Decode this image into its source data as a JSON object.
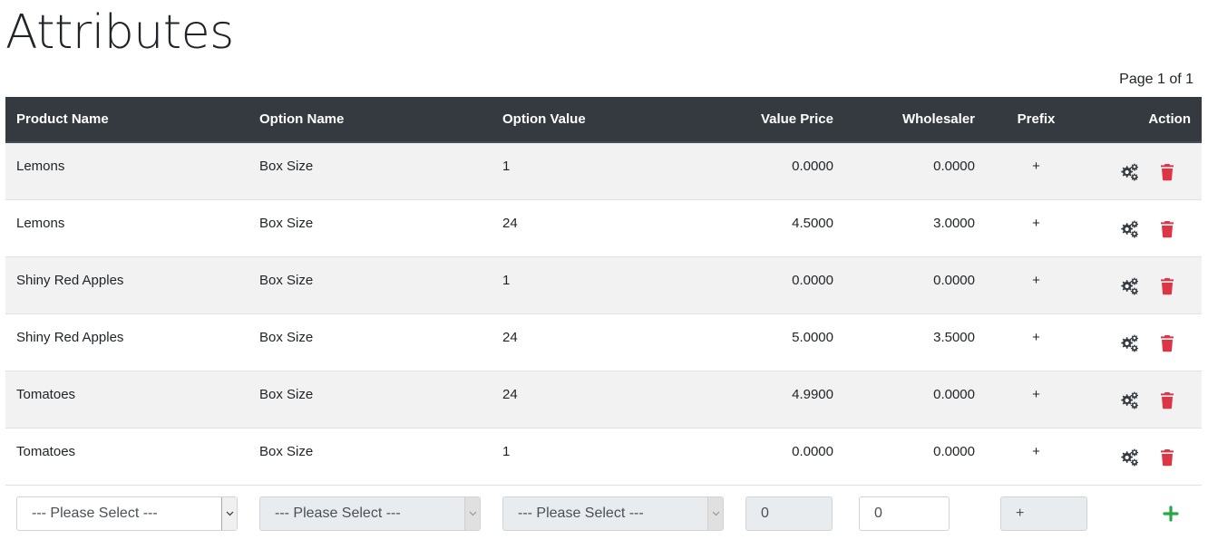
{
  "page": {
    "title": "Attributes",
    "pagination": "Page 1 of 1"
  },
  "table": {
    "headers": {
      "product_name": "Product Name",
      "option_name": "Option Name",
      "option_value": "Option Value",
      "value_price": "Value Price",
      "wholesaler": "Wholesaler",
      "prefix": "Prefix",
      "action": "Action"
    },
    "rows": [
      {
        "product_name": "Lemons",
        "option_name": "Box Size",
        "option_value": "1",
        "value_price": "0.0000",
        "wholesaler": "0.0000",
        "prefix": "+"
      },
      {
        "product_name": "Lemons",
        "option_name": "Box Size",
        "option_value": "24",
        "value_price": "4.5000",
        "wholesaler": "3.0000",
        "prefix": "+"
      },
      {
        "product_name": "Shiny Red Apples",
        "option_name": "Box Size",
        "option_value": "1",
        "value_price": "0.0000",
        "wholesaler": "0.0000",
        "prefix": "+"
      },
      {
        "product_name": "Shiny Red Apples",
        "option_name": "Box Size",
        "option_value": "24",
        "value_price": "5.0000",
        "wholesaler": "3.5000",
        "prefix": "+"
      },
      {
        "product_name": "Tomatoes",
        "option_name": "Box Size",
        "option_value": "24",
        "value_price": "4.9900",
        "wholesaler": "0.0000",
        "prefix": "+"
      },
      {
        "product_name": "Tomatoes",
        "option_name": "Box Size",
        "option_value": "1",
        "value_price": "0.0000",
        "wholesaler": "0.0000",
        "prefix": "+"
      }
    ]
  },
  "add_row": {
    "product_select": "--- Please Select ---",
    "option_select": "--- Please Select ---",
    "value_select": "--- Please Select ---",
    "value_price": "0",
    "wholesaler": "0",
    "prefix": "+"
  },
  "icons": {
    "edit": "cogs-icon",
    "delete": "trash-icon",
    "add": "plus-icon",
    "dropdown": "chevron-down-icon"
  },
  "colors": {
    "header_bg": "#343a40",
    "stripe": "#f2f2f2",
    "danger": "#dc3545",
    "success": "#28a745",
    "icon_dark": "#343a40"
  }
}
